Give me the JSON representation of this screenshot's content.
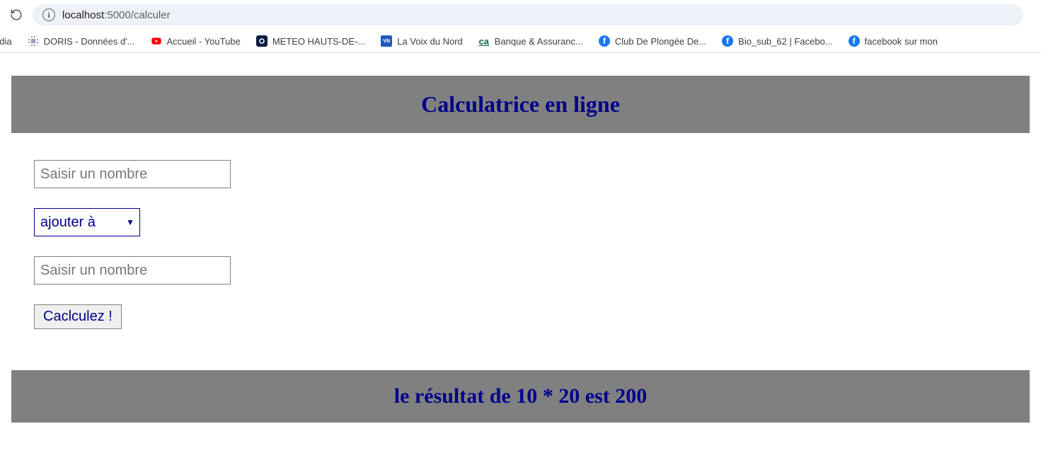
{
  "browser": {
    "url_host": "localhost",
    "url_rest": ":5000/calculer"
  },
  "bookmarks": [
    {
      "label": "édia"
    },
    {
      "label": "DORIS - Données d'..."
    },
    {
      "label": "Accueil - YouTube"
    },
    {
      "label": "METEO HAUTS-DE-..."
    },
    {
      "label": "La Voix du Nord"
    },
    {
      "label": "Banque & Assuranc..."
    },
    {
      "label": "Club De Plongée De..."
    },
    {
      "label": "Bio_sub_62 | Facebo..."
    },
    {
      "label": "facebook sur mon"
    }
  ],
  "page": {
    "title": "Calculatrice en ligne",
    "input1_placeholder": "Saisir un nombre",
    "operator_selected": "ajouter à",
    "input2_placeholder": "Saisir un nombre",
    "submit_label": "Caclculez !",
    "result_text": "le résultat de 10 * 20 est 200"
  },
  "colors": {
    "accent": "#00008b",
    "bar_bg": "#808080"
  }
}
